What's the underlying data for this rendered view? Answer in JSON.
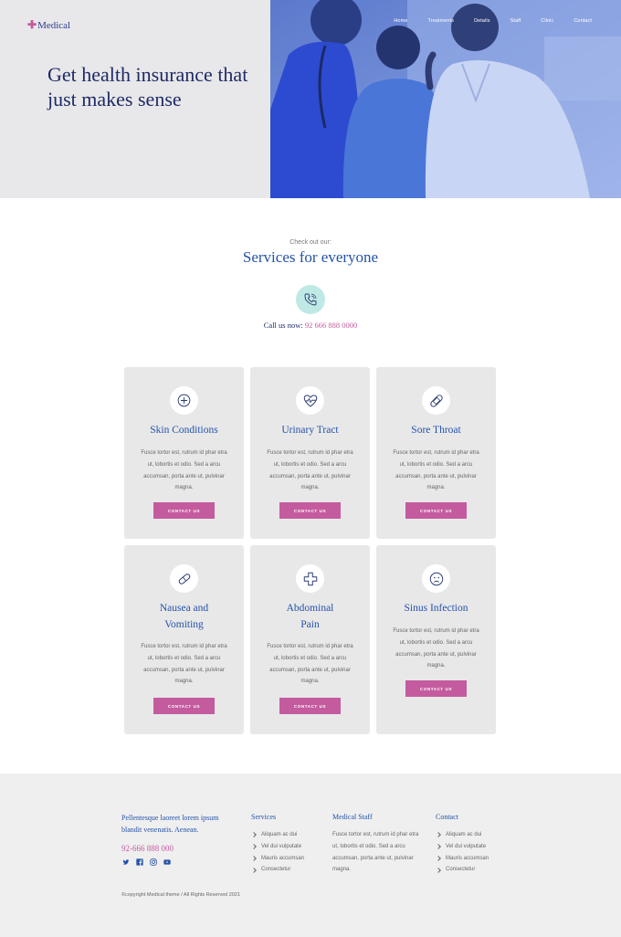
{
  "brand": {
    "logo_text": "Medical",
    "accent": "#c45b9e",
    "primary": "#2452a8",
    "navy": "#1e2a66"
  },
  "nav": [
    "Home",
    "Treatments",
    "Details",
    "Staff",
    "Clinic",
    "Contact"
  ],
  "hero": {
    "title": "Get health insurance that just makes sense"
  },
  "services": {
    "eyebrow": "Check out our:",
    "title": "Services for everyone",
    "call_label": "Call us now:",
    "call_number": "92 666 888 0000"
  },
  "cards": [
    {
      "icon": "plus-circle-icon",
      "title": "Skin Conditions",
      "desc": "Fusce tortor est, rutrum id phar etra ut, lobortis et odio. Sed a arcu accumsan, porta ante ut, pulvinar magna.",
      "button": "CONTACT US"
    },
    {
      "icon": "heart-pulse-icon",
      "title": "Urinary Tract",
      "desc": "Fusce tortor est, rutrum id phar etra ut, lobortis et odio. Sed a arcu accumsan, porta ante ut, pulvinar magna.",
      "button": "CONTACT US"
    },
    {
      "icon": "bandage-icon",
      "title": "Sore Throat",
      "desc": "Fusce tortor est, rutrum id phar etra ut, lobortis et odio. Sed a arcu accumsan, porta ante ut, pulvinar magna.",
      "button": "CONTACT US"
    },
    {
      "icon": "pill-icon",
      "title_l1": "Nausea and",
      "title_l2": "Vomiting",
      "desc": "Fusce tortor est, rutrum id phar etra ut, lobortis et odio. Sed a arcu accumsan, porta ante ut, pulvinar magna.",
      "button": "CONTACT US"
    },
    {
      "icon": "medical-cross-icon",
      "title_l1": "Abdominal",
      "title_l2": "Pain",
      "desc": "Fusce tortor est, rutrum id phar etra ut, lobortis et odio. Sed a arcu accumsan, porta ante ut, pulvinar magna.",
      "button": "CONTACT US"
    },
    {
      "icon": "sick-face-icon",
      "title": "Sinus Infection",
      "desc": "Fusce tortor est, rutrum id phar etra ut, lobortis et odio. Sed a arcu accumsan, porta ante ut, pulvinar magna.",
      "button": "CONTACT US"
    }
  ],
  "footer": {
    "tagline": "Pellentesque laoreet lorem ipsum blandit venenatis. Aenean.",
    "phone": "92-666 888 000",
    "social": [
      "twitter-icon",
      "facebook-icon",
      "instagram-icon",
      "youtube-icon"
    ],
    "services_head": "Services",
    "services_items": [
      "Aliquam ac dui",
      "Vel dui vulputate",
      "Mauris accumsan",
      "Consectetur"
    ],
    "staff_head": "Medical Staff",
    "staff_text": "Fusce tortor est, rutrum id phar etra ut, lobortis et odio. Sed a arcu accumsan, porta ante ut, pulvinar magna.",
    "contact_head": "Contact",
    "contact_items": [
      "Aliquam ac dui",
      "Vel dui vulputate",
      "Mauris accumsan",
      "Consectetur"
    ],
    "copyright": "©copyright Medical theme / All Rights Reserved 2021"
  }
}
